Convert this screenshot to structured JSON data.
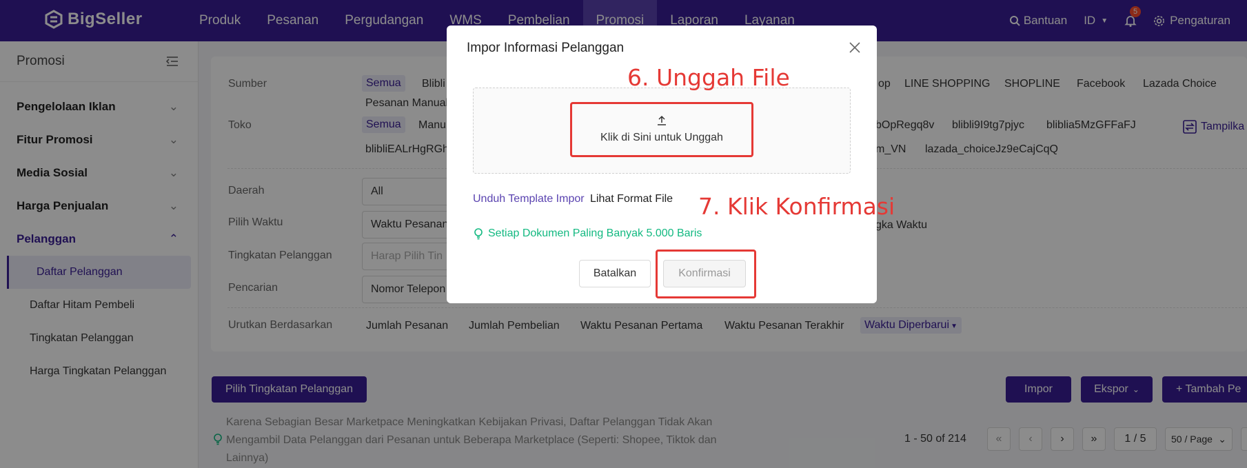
{
  "brand": {
    "name": "BigSeller"
  },
  "nav": {
    "items": [
      "Produk",
      "Pesanan",
      "Pergudangan",
      "WMS",
      "Pembelian",
      "Promosi",
      "Laporan",
      "Layanan"
    ],
    "active_index": 5,
    "help": "Bantuan",
    "lang": "ID",
    "notif_count": "5",
    "settings": "Pengaturan"
  },
  "sidebar": {
    "title": "Promosi",
    "groups": [
      "Pengelolaan Iklan",
      "Fitur Promosi",
      "Media Sosial",
      "Harga Penjualan",
      "Pelanggan"
    ],
    "subitems": [
      "Daftar Pelanggan",
      "Daftar Hitam Pembeli",
      "Tingkatan Pelanggan",
      "Harga Tingkatan Pelanggan"
    ]
  },
  "filters": {
    "sumber_label": "Sumber",
    "sumber_all": "Semua",
    "sumber_visible": [
      "Blibli",
      "Pesanan Manual",
      "op",
      "LINE SHOPPING",
      "SHOPLINE",
      "Facebook",
      "Lazada Choice"
    ],
    "toko_label": "Toko",
    "toko_all": "Semua",
    "toko_visible": [
      "Manu",
      "blibliEALrHgRGh",
      "bOpRegq8v",
      "blibli9I9tg7pjyc",
      "bliblia5MzGFFaFJ",
      "m_VN",
      "lazada_choiceJz9eCajCqQ"
    ],
    "toko_show": "Tampilka",
    "daerah_label": "Daerah",
    "daerah_value": "All",
    "waktu_label": "Pilih Waktu",
    "waktu_value": "Waktu Pesanan",
    "waktu_range": "gka Waktu",
    "tingkatan_label": "Tingkatan Pelanggan",
    "tingkatan_placeholder": "Harap Pilih Tin",
    "pencarian_label": "Pencarian",
    "pencarian_value": "Nomor Telepon",
    "urut_label": "Urutkan Berdasarkan",
    "urut_options": [
      "Jumlah Pesanan",
      "Jumlah Pembelian",
      "Waktu Pesanan Pertama",
      "Waktu Pesanan Terakhir"
    ],
    "urut_selected": "Waktu Diperbarui"
  },
  "actions": {
    "pilih_tingkatan": "Pilih Tingkatan Pelanggan",
    "impor": "Impor",
    "ekspor": "Ekspor",
    "tambah": "+ Tambah Pe"
  },
  "notice": "Karena Sebagian Besar Marketpace Meningkatkan Kebijakan Privasi, Daftar Pelanggan Tidak Akan Mengambil Data Pelanggan dari Pesanan untuk Beberapa Marketplace (Seperti: Shopee, Tiktok dan Lainnya)",
  "pagination": {
    "range": "1 - 50 of 214",
    "page": "1 / 5",
    "per_page": "50 / Page"
  },
  "modal": {
    "title": "Impor Informasi Pelanggan",
    "upload_text": "Klik di Sini untuk Unggah",
    "step6": "6. Unggah File",
    "step7": "7. Klik Konfirmasi",
    "download_template": "Unduh Template Impor",
    "view_format": "Lihat Format File",
    "tip": "Setiap Dokumen Paling Banyak 5.000 Baris",
    "cancel": "Batalkan",
    "confirm": "Konfirmasi"
  },
  "colors": {
    "primary": "#3a1e96",
    "annotation": "#e53935",
    "tip": "#13b981",
    "link": "#5a43b0"
  }
}
